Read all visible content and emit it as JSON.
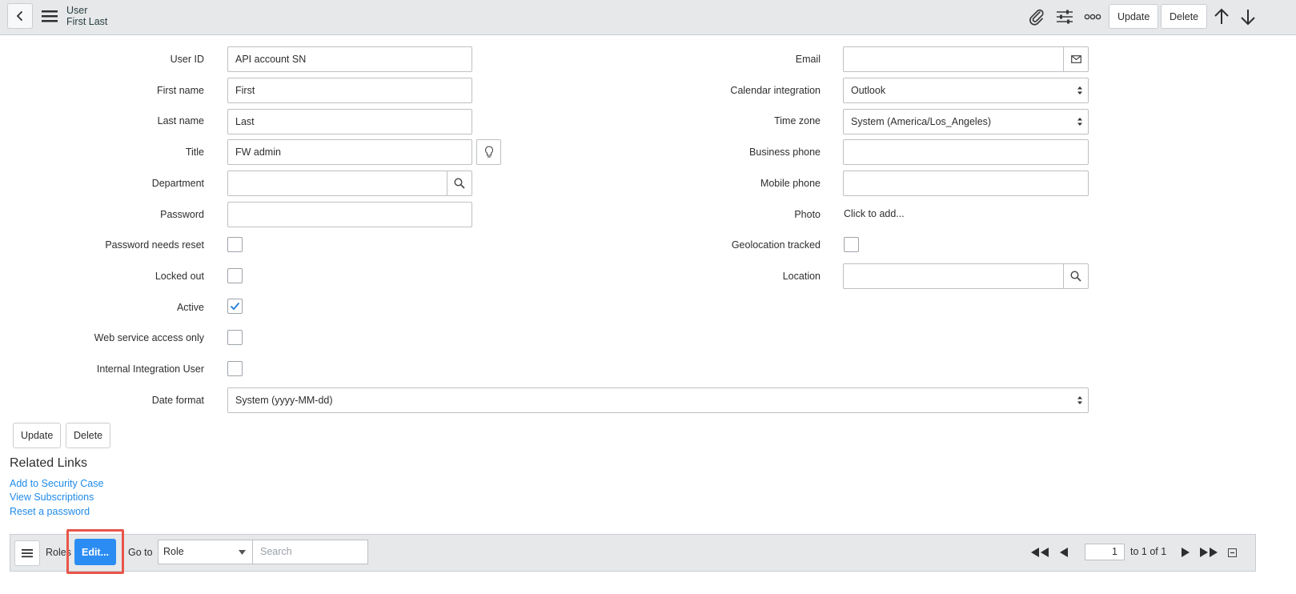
{
  "header": {
    "record_type": "User",
    "record_name": "First Last",
    "update_label": "Update",
    "delete_label": "Delete"
  },
  "form": {
    "left": {
      "user_id": {
        "label": "User ID",
        "value": "API account SN"
      },
      "first_name": {
        "label": "First name",
        "value": "First"
      },
      "last_name": {
        "label": "Last name",
        "value": "Last"
      },
      "title": {
        "label": "Title",
        "value": "FW admin"
      },
      "department": {
        "label": "Department",
        "value": ""
      },
      "password": {
        "label": "Password",
        "value": ""
      },
      "password_needs_reset": {
        "label": "Password needs reset",
        "checked": false
      },
      "locked_out": {
        "label": "Locked out",
        "checked": false
      },
      "active": {
        "label": "Active",
        "checked": true
      },
      "web_service_access_only": {
        "label": "Web service access only",
        "checked": false
      },
      "internal_integration_user": {
        "label": "Internal Integration User",
        "checked": false
      }
    },
    "right": {
      "email": {
        "label": "Email",
        "value": ""
      },
      "calendar_integration": {
        "label": "Calendar integration",
        "value": "Outlook"
      },
      "time_zone": {
        "label": "Time zone",
        "value": "System (America/Los_Angeles)"
      },
      "business_phone": {
        "label": "Business phone",
        "value": ""
      },
      "mobile_phone": {
        "label": "Mobile phone",
        "value": ""
      },
      "photo": {
        "label": "Photo",
        "value": "Click to add..."
      },
      "geolocation_tracked": {
        "label": "Geolocation tracked",
        "checked": false
      },
      "location": {
        "label": "Location",
        "value": ""
      }
    },
    "date_format": {
      "label": "Date format",
      "value": "System (yyyy-MM-dd)"
    },
    "update_label": "Update",
    "delete_label": "Delete"
  },
  "related_links": {
    "title": "Related Links",
    "links": [
      "Add to Security Case",
      "View Subscriptions",
      "Reset a password"
    ]
  },
  "related_list": {
    "tab_label": "Roles",
    "edit_label": "Edit...",
    "goto_label": "Go to",
    "goto_field": "Role",
    "search_placeholder": "Search",
    "current_page": "1",
    "page_info": "to 1 of 1"
  },
  "colors": {
    "accent": "#2b8df4",
    "link": "#1f8ae8",
    "highlight": "#e8554a",
    "header_bg": "#e6e8ea"
  },
  "icons": {
    "back": "chevron-left-icon",
    "menu": "hamburger-icon",
    "attachment": "paperclip-icon",
    "personalize": "sliders-icon",
    "more": "more-options-icon",
    "previous_record": "arrow-up-icon",
    "next_record": "arrow-down-icon",
    "email": "envelope-icon",
    "lookup": "magnifier-icon",
    "suggestion": "lightbulb-icon"
  }
}
